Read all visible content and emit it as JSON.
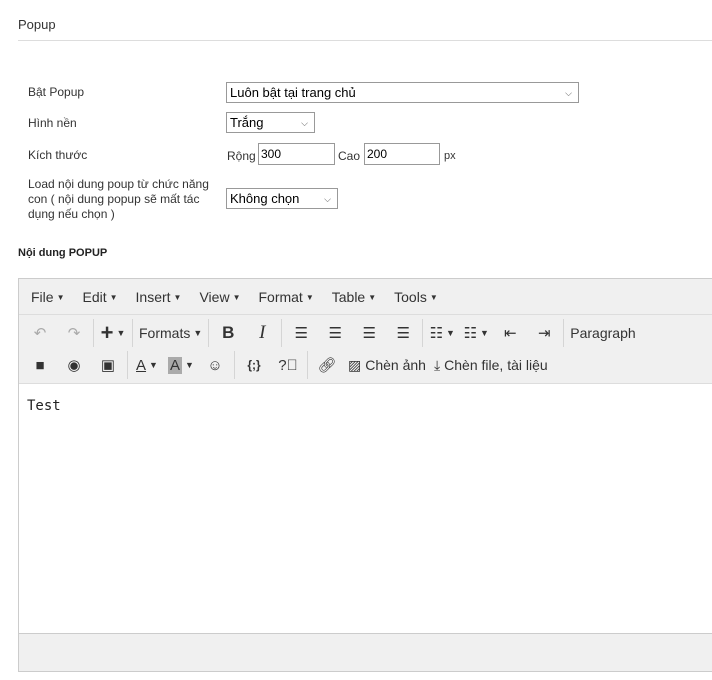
{
  "section_title": "Popup",
  "form": {
    "enable_label": "Bật Popup",
    "enable_value": "Luôn bật tại trang chủ",
    "background_label": "Hình nền",
    "background_value": "Trắng",
    "size_label": "Kích thước",
    "width_label": "Rộng",
    "width_value": "300",
    "height_label": "Cao",
    "height_value": "200",
    "unit": "px",
    "load_label": "Load nội dung poup từ chức năng con ( nội dung popup sẽ mất tác dụng nếu chọn )",
    "load_value": "Không chọn"
  },
  "content_title": "Nội dung POPUP",
  "editor": {
    "menus": [
      "File",
      "Edit",
      "Insert",
      "View",
      "Format",
      "Table",
      "Tools"
    ],
    "formats_label": "Formats",
    "paragraph_label": "Paragraph",
    "insert_image_label": "Chèn ảnh",
    "insert_file_label": "Chèn file, tài liệu",
    "content": "Test"
  }
}
